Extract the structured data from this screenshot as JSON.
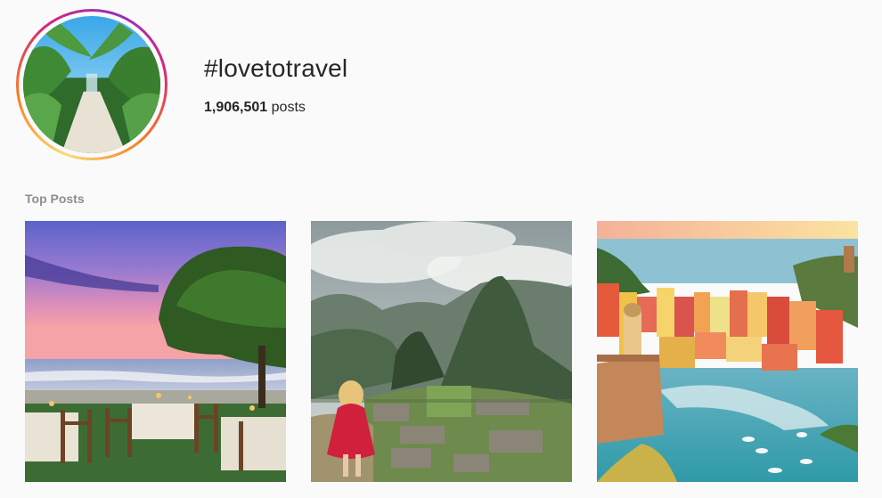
{
  "header": {
    "hashtag": "#lovetotravel",
    "post_count": "1,906,501",
    "post_count_suffix": "posts"
  },
  "top_posts": {
    "label": "Top Posts",
    "posts": [
      {
        "scene": "sunset-beach-dinner"
      },
      {
        "scene": "machu-picchu"
      },
      {
        "scene": "cinque-terre-vernazza"
      }
    ]
  },
  "colors": {
    "background": "#fafafa",
    "text": "#262626",
    "muted": "#8e8e8e",
    "ring_orange": "#fa7e1e",
    "ring_pink": "#d62976"
  }
}
